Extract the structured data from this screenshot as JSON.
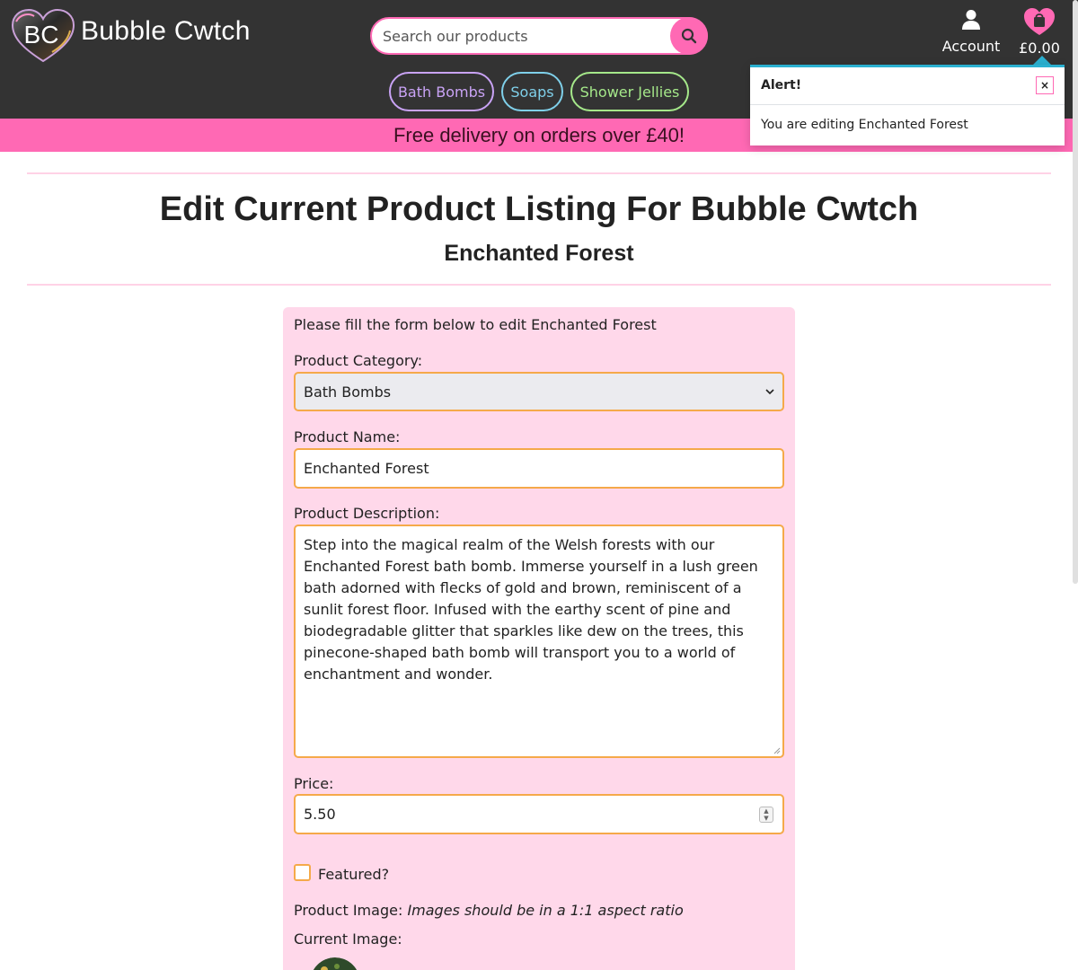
{
  "header": {
    "logo_initials": "BC",
    "brand": "Bubble Cwtch",
    "search_placeholder": "Search our products",
    "account_label": "Account",
    "cart_total": "£0.00",
    "categories": [
      "Bath Bombs",
      "Soaps",
      "Shower Jellies"
    ]
  },
  "promo": "Free delivery on orders over £40!",
  "alert": {
    "title": "Alert!",
    "close": "×",
    "message": "You are editing Enchanted Forest"
  },
  "page": {
    "title": "Edit Current Product Listing For Bubble Cwtch",
    "subtitle": "Enchanted Forest"
  },
  "form": {
    "intro": "Please fill the form below to edit Enchanted Forest",
    "category_label": "Product Category:",
    "category_value": "Bath Bombs",
    "name_label": "Product Name:",
    "name_value": "Enchanted Forest",
    "description_label": "Product Description:",
    "description_value": "Step into the magical realm of the Welsh forests with our Enchanted Forest bath bomb. Immerse yourself in a lush green bath adorned with flecks of gold and brown, reminiscent of a sunlit forest floor. Infused with the earthy scent of pine and biodegradable glitter that sparkles like dew on the trees, this pinecone-shaped bath bomb will transport you to a world of enchantment and wonder.",
    "price_label": "Price:",
    "price_value": "5.50",
    "featured_label": "Featured?",
    "featured_checked": false,
    "image_label": "Product Image:",
    "image_hint": "Images should be in a 1:1 aspect ratio",
    "current_image_label": "Current Image:"
  },
  "colors": {
    "header_bg": "#333333",
    "accent_pink": "#ff69b4",
    "card_bg": "#ffd8ea",
    "field_border": "#f5a94a",
    "alert_accent": "#2ab0d0"
  }
}
